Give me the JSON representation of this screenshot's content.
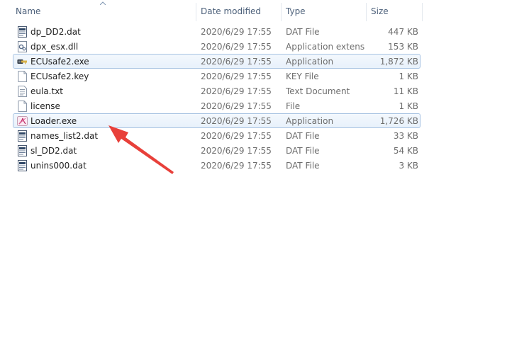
{
  "columns": {
    "name": "Name",
    "date": "Date modified",
    "type": "Type",
    "size": "Size"
  },
  "files": [
    {
      "name": "dp_DD2.dat",
      "date": "2020/6/29 17:55",
      "type": "DAT File",
      "size": "447 KB",
      "icon": "dat-file-icon",
      "selected": false
    },
    {
      "name": "dpx_esx.dll",
      "date": "2020/6/29 17:55",
      "type": "Application extens...",
      "size": "153 KB",
      "icon": "dll-file-icon",
      "selected": false
    },
    {
      "name": "ECUsafe2.exe",
      "date": "2020/6/29 17:55",
      "type": "Application",
      "size": "1,872 KB",
      "icon": "key-app-icon",
      "selected": true
    },
    {
      "name": "ECUsafe2.key",
      "date": "2020/6/29 17:55",
      "type": "KEY File",
      "size": "1 KB",
      "icon": "blank-file-icon",
      "selected": false
    },
    {
      "name": "eula.txt",
      "date": "2020/6/29 17:55",
      "type": "Text Document",
      "size": "11 KB",
      "icon": "text-file-icon",
      "selected": false
    },
    {
      "name": "license",
      "date": "2020/6/29 17:55",
      "type": "File",
      "size": "1 KB",
      "icon": "blank-file-icon",
      "selected": false
    },
    {
      "name": "Loader.exe",
      "date": "2020/6/29 17:55",
      "type": "Application",
      "size": "1,726 KB",
      "icon": "loader-app-icon",
      "selected": true
    },
    {
      "name": "names_list2.dat",
      "date": "2020/6/29 17:55",
      "type": "DAT File",
      "size": "33 KB",
      "icon": "dat-file-icon",
      "selected": false
    },
    {
      "name": "sl_DD2.dat",
      "date": "2020/6/29 17:55",
      "type": "DAT File",
      "size": "54 KB",
      "icon": "dat-file-icon",
      "selected": false
    },
    {
      "name": "unins000.dat",
      "date": "2020/6/29 17:55",
      "type": "DAT File",
      "size": "3 KB",
      "icon": "dat-file-icon",
      "selected": false
    }
  ],
  "colors": {
    "selection_border": "#a8c3e2",
    "header_text": "#4c607a",
    "annotation_arrow": "#e8403a"
  }
}
